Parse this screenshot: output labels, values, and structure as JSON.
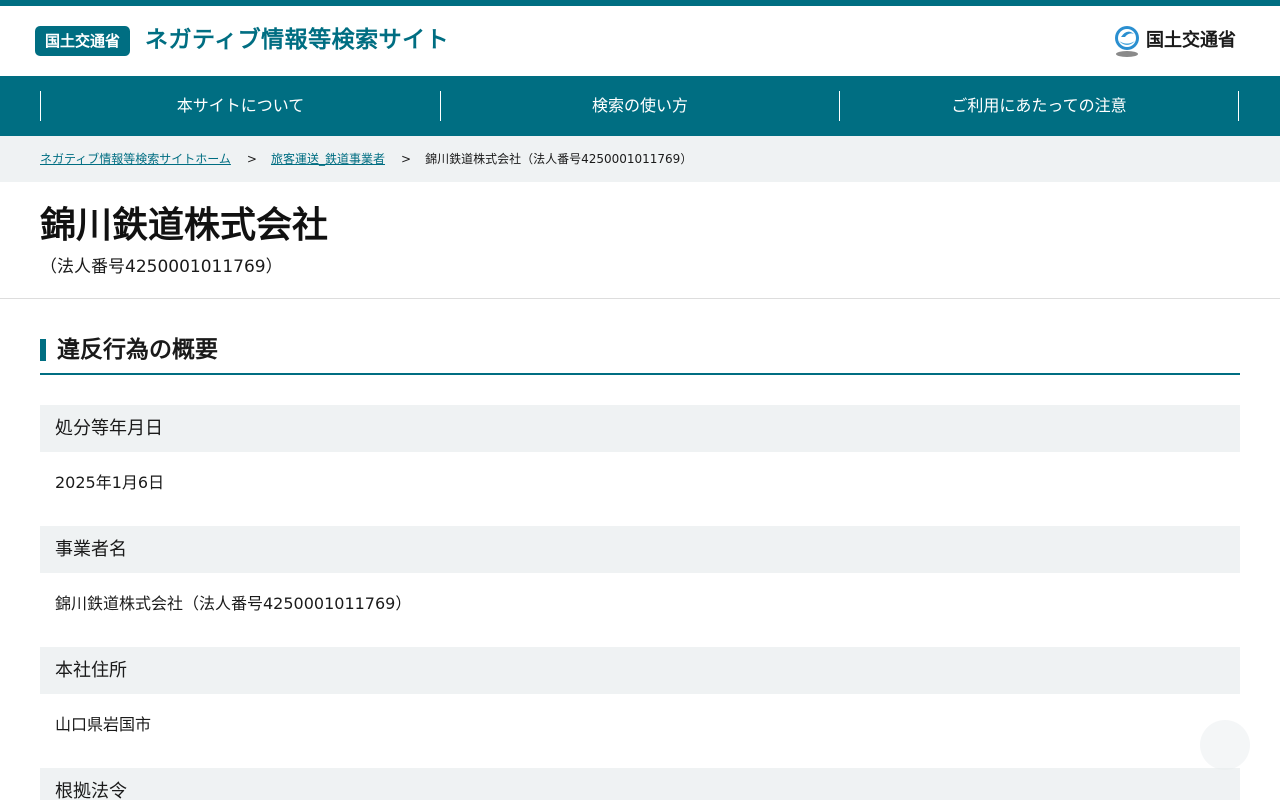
{
  "header": {
    "badge": "国土交通省",
    "site_title": "ネガティブ情報等検索サイト",
    "logo_text": "国土交通省"
  },
  "nav": [
    {
      "label": "本サイトについて"
    },
    {
      "label": "検索の使い方"
    },
    {
      "label": "ご利用にあたっての注意"
    }
  ],
  "breadcrumb": {
    "home": "ネガティブ情報等検索サイトホーム",
    "category": "旅客運送_鉄道事業者",
    "current": "錦川鉄道株式会社（法人番号4250001011769）",
    "separator": ">"
  },
  "company": {
    "name": "錦川鉄道株式会社",
    "corporate_number": "（法人番号4250001011769）"
  },
  "section": {
    "title": "違反行為の概要"
  },
  "details": [
    {
      "label": "処分等年月日",
      "value": "2025年1月6日"
    },
    {
      "label": "事業者名",
      "value": "錦川鉄道株式会社（法人番号4250001011769）"
    },
    {
      "label": "本社住所",
      "value": "山口県岩国市"
    },
    {
      "label": "根拠法令",
      "value": ""
    }
  ],
  "colors": {
    "brand": "#006e82",
    "panel": "#eff2f3"
  }
}
